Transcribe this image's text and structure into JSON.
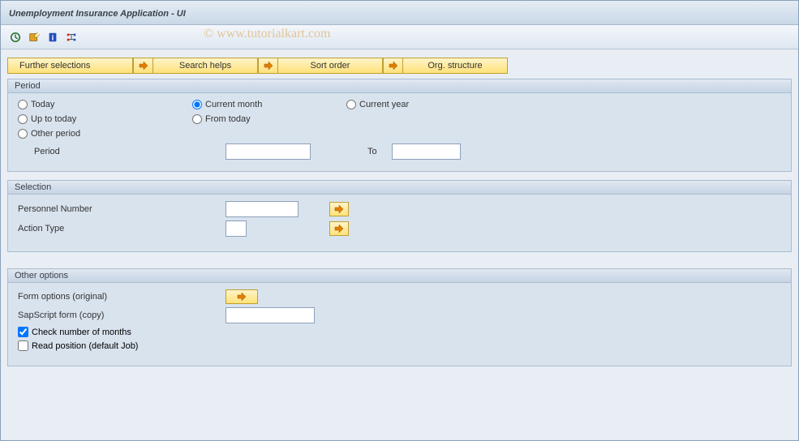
{
  "title": "Unemployment Insurance Application - UI",
  "watermark": "© www.tutorialkart.com",
  "topButtons": {
    "further": "Further selections",
    "search": "Search helps",
    "sort": "Sort order",
    "org": "Org. structure"
  },
  "period": {
    "legend": "Period",
    "today": "Today",
    "upToToday": "Up to today",
    "otherPeriod": "Other period",
    "currentMonth": "Current month",
    "fromToday": "From today",
    "currentYear": "Current year",
    "periodLabel": "Period",
    "toLabel": "To",
    "periodFrom": "",
    "periodTo": "",
    "selected": "currentMonth"
  },
  "selection": {
    "legend": "Selection",
    "personnelNumber": {
      "label": "Personnel Number",
      "value": ""
    },
    "actionType": {
      "label": "Action Type",
      "value": ""
    }
  },
  "other": {
    "legend": "Other options",
    "formOptions": {
      "label": "Form options (original)"
    },
    "sapscript": {
      "label": "SapScript form (copy)",
      "value": ""
    },
    "checkMonths": {
      "label": "Check number of months",
      "checked": true
    },
    "readPosition": {
      "label": "Read position (default Job)",
      "checked": false
    }
  }
}
